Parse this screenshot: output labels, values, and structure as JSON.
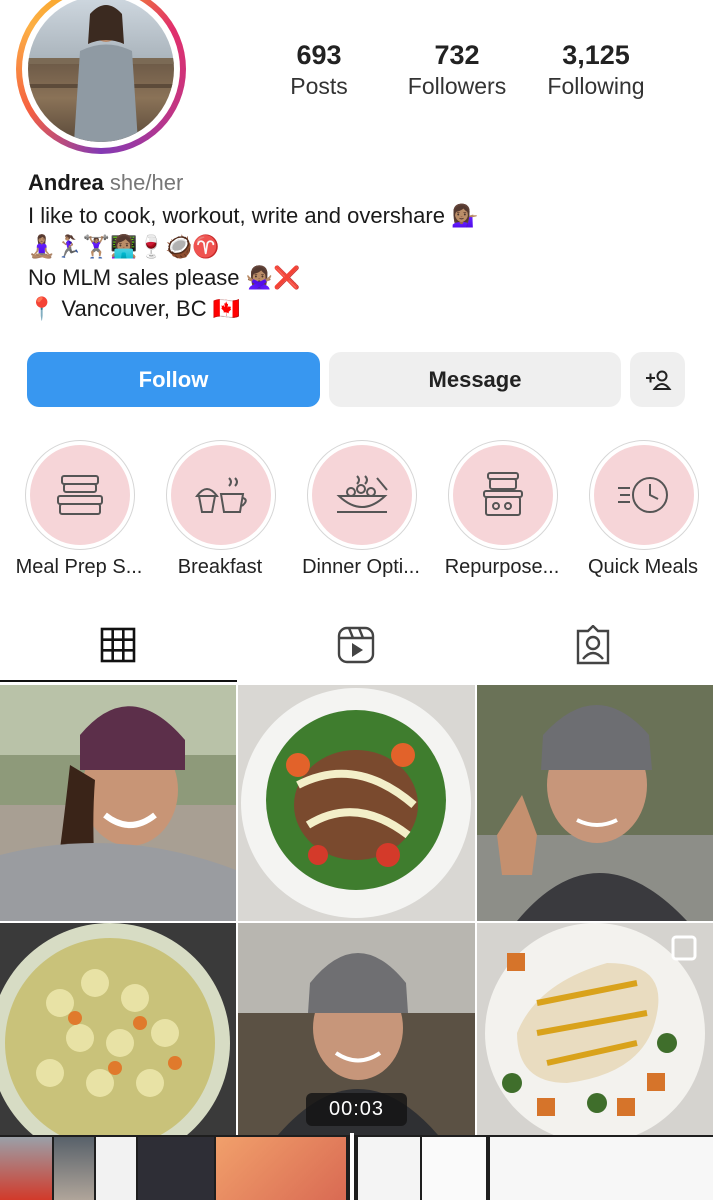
{
  "profile": {
    "username": "Andrea",
    "pronouns": "she/her",
    "bio_line1": "I like to cook, workout, write and overshare 💁🏽‍♀️",
    "bio_line2": "🧘🏽‍♀️🏃🏽‍♀️🏋🏽‍♀️👩🏽‍💻🍷🥥♈",
    "bio_line3": "No MLM sales please 🙅🏽‍♀️❌",
    "bio_line4": "📍 Vancouver, BC 🇨🇦"
  },
  "stats": [
    {
      "value": "693",
      "label": "Posts"
    },
    {
      "value": "732",
      "label": "Followers"
    },
    {
      "value": "3,125",
      "label": "Following"
    }
  ],
  "actions": {
    "follow": "Follow",
    "message": "Message"
  },
  "highlights": [
    {
      "label": "Meal Prep S...",
      "icon": "meal-prep-containers-icon"
    },
    {
      "label": "Breakfast",
      "icon": "muffin-coffee-icon"
    },
    {
      "label": "Dinner Opti...",
      "icon": "dinner-bowl-icon"
    },
    {
      "label": "Repurpose...",
      "icon": "stacked-containers-icon"
    },
    {
      "label": "Quick Meals",
      "icon": "timer-clock-icon"
    }
  ],
  "tabs": [
    "grid-icon",
    "reels-icon",
    "tagged-icon"
  ],
  "video": {
    "timestamp": "00:03"
  },
  "colors": {
    "follow": "#3897f0",
    "highlight_bg": "#f6d5d8",
    "ring": "#e1306c"
  }
}
